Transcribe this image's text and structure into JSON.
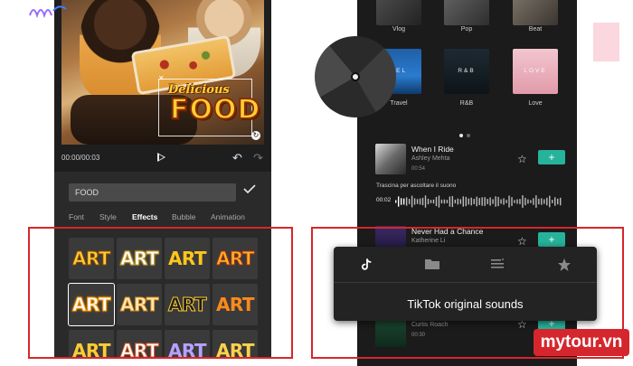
{
  "left_editor": {
    "timecode": "00:00/00:03",
    "overlay_line1": "Delicious",
    "overlay_line2": "FOOD",
    "text_input_value": "FOOD",
    "tabs": [
      "Font",
      "Style",
      "Effects",
      "Bubble",
      "Animation"
    ],
    "active_tab": "Effects",
    "art_tiles": [
      "ART",
      "ART",
      "ART",
      "ART",
      "ART",
      "ART",
      "ART",
      "ART",
      "ART",
      "ART",
      "ART",
      "ART"
    ]
  },
  "right_library": {
    "albums_top": [
      "Vlog",
      "Pop",
      "Beat"
    ],
    "albums_mid": [
      "Travel",
      "R&B",
      "Love"
    ],
    "album_art_text": [
      "VEL",
      "R&B",
      "LOVE"
    ],
    "tracks": [
      {
        "title": "When I Ride",
        "artist": "Ashley Mehta",
        "duration": "00:54"
      },
      {
        "title": "Never Had a Chance",
        "artist": "Katherine Li",
        "duration": ""
      },
      {
        "title": "",
        "artist": "Curtis Roach",
        "duration": "00:30"
      }
    ],
    "drag_hint": "Trascina per ascoltare il suono",
    "waveform_time": "00:02",
    "add_symbol": "+"
  },
  "tiktok_sheet": {
    "title": "TikTok original sounds",
    "icons": [
      "tiktok-icon",
      "folder-icon",
      "playlist-icon",
      "star-icon"
    ]
  },
  "watermark": "mytour.vn",
  "colors": {
    "highlight_red": "#d7262a",
    "accent_teal": "#26b39a",
    "art_yellow": "#ffc833"
  }
}
